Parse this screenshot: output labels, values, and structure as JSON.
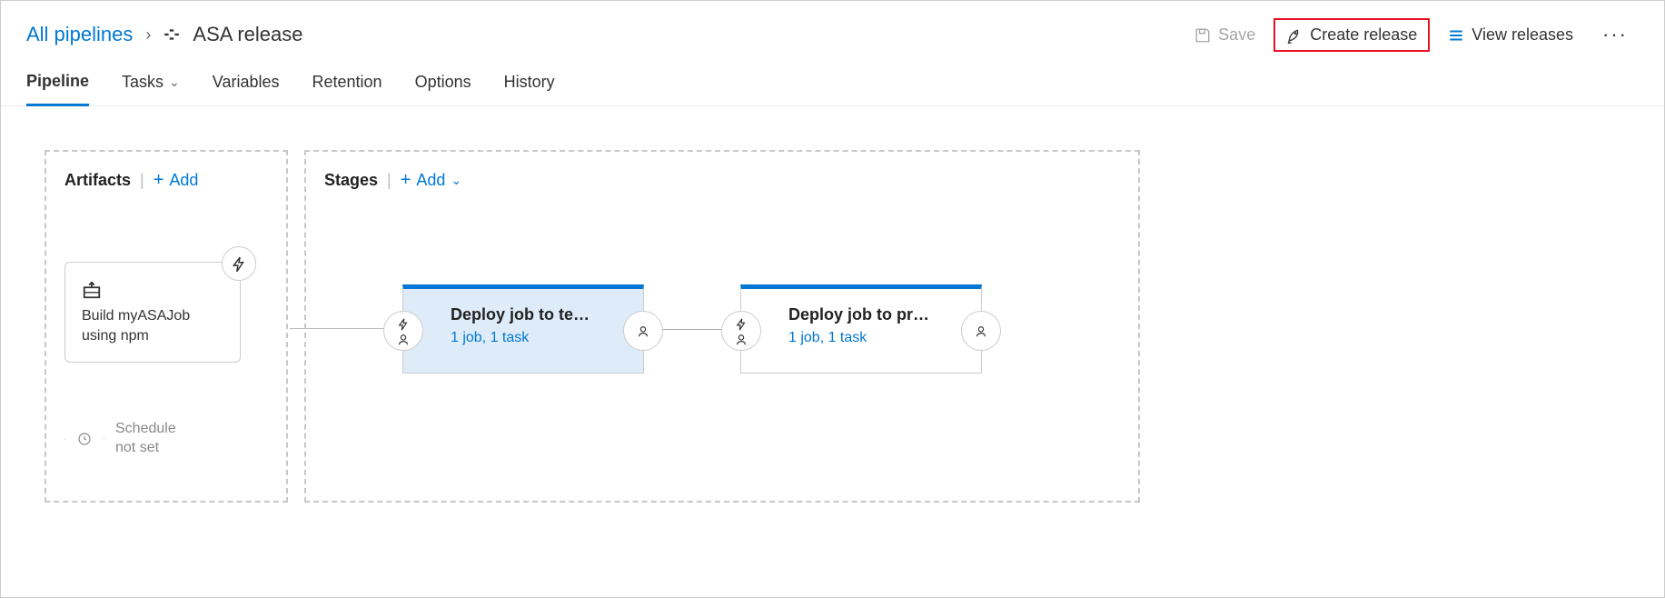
{
  "breadcrumb": {
    "root": "All pipelines",
    "current": "ASA release"
  },
  "actions": {
    "save": "Save",
    "create_release": "Create release",
    "view_releases": "View releases"
  },
  "tabs": [
    "Pipeline",
    "Tasks",
    "Variables",
    "Retention",
    "Options",
    "History"
  ],
  "artifacts": {
    "title": "Artifacts",
    "add": "Add",
    "card": {
      "name": "Build myASAJob using npm"
    },
    "schedule": "Schedule not set"
  },
  "stages": {
    "title": "Stages",
    "add": "Add",
    "items": [
      {
        "name": "Deploy job to test...",
        "meta": "1 job, 1 task",
        "selected": true
      },
      {
        "name": "Deploy job to pro...",
        "meta": "1 job, 1 task",
        "selected": false
      }
    ]
  }
}
